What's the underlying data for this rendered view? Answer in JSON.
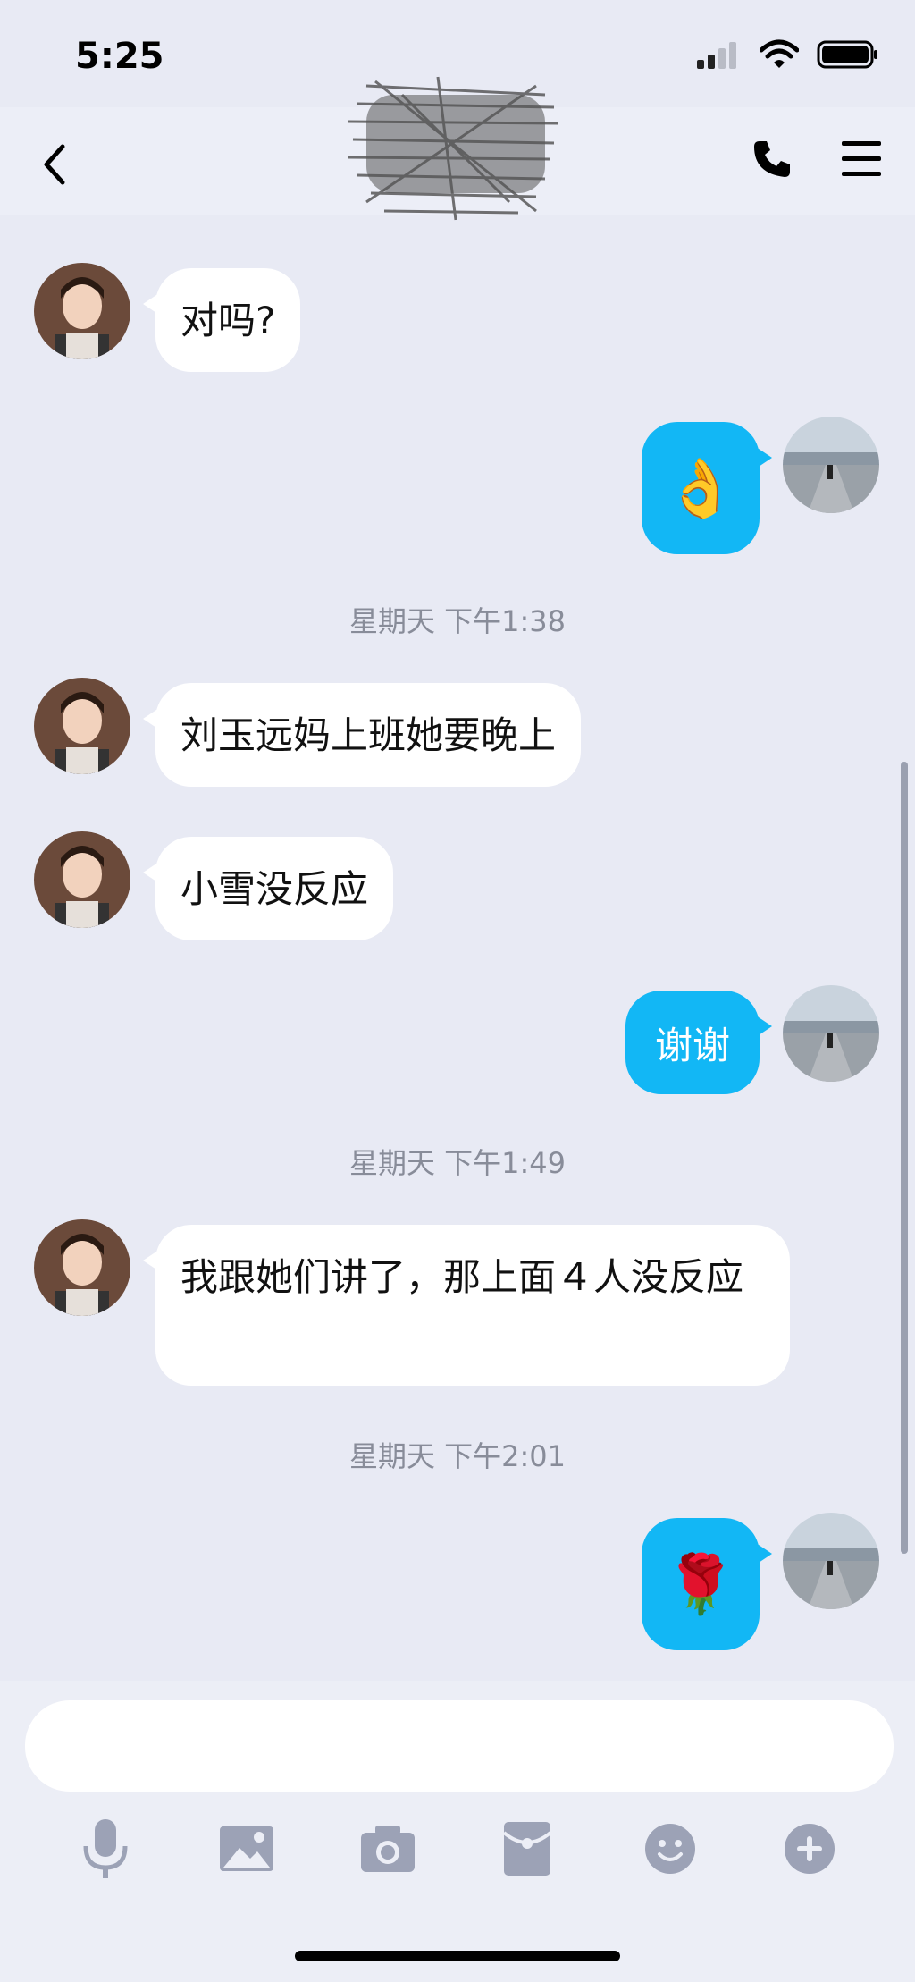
{
  "status_bar": {
    "time": "5:25"
  },
  "icons": {
    "back": "chevron-left-icon",
    "call": "phone-icon",
    "menu": "menu-icon",
    "signal": "signal-icon",
    "wifi": "wifi-icon",
    "battery": "battery-icon"
  },
  "messages": [
    {
      "side": "in",
      "text": "对吗?"
    },
    {
      "side": "out",
      "emoji": "👌"
    },
    {
      "timestamp": "星期天 下午1:38"
    },
    {
      "side": "in",
      "text": "刘玉远妈上班她要晚上"
    },
    {
      "side": "in",
      "text": "小雪没反应"
    },
    {
      "side": "out",
      "text": "谢谢"
    },
    {
      "timestamp": "星期天 下午1:49"
    },
    {
      "side": "in",
      "text": "我跟她们讲了，那上面４人没反应"
    },
    {
      "timestamp": "星期天 下午2:01"
    },
    {
      "side": "out",
      "emoji": "🌹"
    }
  ],
  "input": {
    "value": "",
    "placeholder": ""
  },
  "toolbar": [
    "microphone-icon",
    "image-icon",
    "camera-icon",
    "red-packet-icon",
    "emoji-icon",
    "plus-icon"
  ],
  "colors": {
    "accent": "#12b7f5",
    "background": "#e8eaf4",
    "bubble_in": "#ffffff"
  }
}
